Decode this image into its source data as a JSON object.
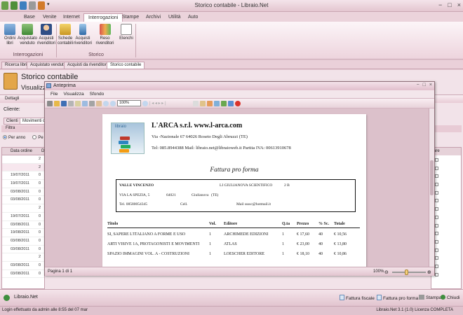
{
  "app": {
    "title": "Storico contabile - Libraio.Net",
    "qat_icons": [
      "app-icon",
      "save-icon",
      "refresh-icon",
      "print-icon",
      "undo-icon",
      "dropdown-icon"
    ],
    "window_controls": [
      "−",
      "□",
      "×"
    ]
  },
  "ribbon": {
    "tabs": [
      "Base",
      "Venite",
      "Internet",
      "Interrogazioni",
      "Stampe",
      "Archivi",
      "Utilità",
      "Auto"
    ],
    "active_tab": "Interrogazioni",
    "groups": [
      {
        "label": "Interrogazioni",
        "buttons": [
          {
            "label1": "Ordini",
            "label2": "libri",
            "icon": "books-order-icon"
          },
          {
            "label1": "Acquistato",
            "label2": "venduto",
            "icon": "purchase-sales-icon"
          },
          {
            "label1": "Acquisti",
            "label2": "rivenditori",
            "icon": "reseller-purchase-icon"
          }
        ]
      },
      {
        "label": "Storico",
        "buttons": [
          {
            "label1": "Schede",
            "label2": "contabili",
            "icon": "accounting-cards-icon"
          },
          {
            "label1": "Acquisti",
            "label2": "rivenditori",
            "icon": "reseller-history-icon"
          },
          {
            "label1": "Reso rivenditori",
            "label2": "",
            "icon": "returns-icon"
          },
          {
            "label1": "Elenchi",
            "label2": "",
            "icon": "lists-icon"
          }
        ]
      }
    ]
  },
  "doc_tabs": [
    "Ricerca libri",
    "Acquistato venduto",
    "Acquisti da rivenditore",
    "Storico contabile"
  ],
  "doc_tab_active": "Storico contabile",
  "main": {
    "title": "Storico contabile",
    "subtitle": "Visualizza",
    "section": "Dettagli",
    "cliente_label": "Cliente:",
    "subtabs": [
      "Clienti",
      "Movimenti co"
    ],
    "filter_label": "Filtra",
    "radio_options": [
      "Per anno",
      "Pe"
    ],
    "grid_header": "Data ordine",
    "grid_header2": "D",
    "grid_rows": [
      {
        "date": "",
        "c": "2"
      },
      {
        "date": "",
        "c": "2"
      },
      {
        "date": "19/07/2011",
        "c": "0"
      },
      {
        "date": "19/07/2011",
        "c": "0"
      },
      {
        "date": "03/08/2011",
        "c": "0"
      },
      {
        "date": "03/08/2011",
        "c": "0"
      },
      {
        "date": "",
        "c": "2"
      },
      {
        "date": "19/07/2011",
        "c": "0"
      },
      {
        "date": "03/08/2011",
        "c": "0"
      },
      {
        "date": "19/08/2011",
        "c": "0"
      },
      {
        "date": "03/08/2011",
        "c": "0"
      },
      {
        "date": "03/08/2011",
        "c": "0"
      },
      {
        "date": "",
        "c": "2"
      },
      {
        "date": "03/08/2011",
        "c": "0"
      },
      {
        "date": "03/08/2011",
        "c": "0"
      }
    ],
    "right_header": "are"
  },
  "preview": {
    "title": "Anteprima",
    "menu": [
      "File",
      "Visualizza",
      "Sfondo"
    ],
    "zoom": "100%",
    "page_status": "Pagina 1 di 1",
    "zoom_status": "100%",
    "invoice": {
      "logo_text": "libraio",
      "company": "L'ARCA s.r.l.  www.l-arca.com",
      "address": "Via -Nazionale 67 64026 Roseto Degli Abruzzi (TE)",
      "contacts": "Tel: 085.8944388 Mail: libraio.net@libraioweb.it Partita IVA: 00613910678",
      "doc_type": "Fattura pro forma",
      "customer": {
        "name": "VALLE VINCENZO",
        "school": "LI GIULIANOVA SCIENTIFICO",
        "class": "2 B",
        "street": "VIA LA SPEZIA, 5",
        "cap": "64021",
        "city": "Giulianova",
        "prov": "(TE)",
        "phone": "Tel. 08580054345",
        "cell": "Cell.",
        "mail": "Mail ssssc@hotmail.it"
      },
      "columns": [
        "Titolo",
        "Vol.",
        "Editore",
        "Q.ta",
        "Prezzo",
        "% Sc.",
        "Totale"
      ],
      "rows": [
        {
          "titolo": "SI, SAPERE L'ITALIANO A FORME E USO",
          "vol": "1",
          "editore": "ARCHIMEDE EDIZIONI",
          "qta": "1",
          "prezzo": "€ 17,60",
          "sc": "40",
          "totale": "€ 10,56"
        },
        {
          "titolo": "ARTI VISIVE 1A, PROTAGONISTI E MOVIMENTI",
          "vol": "1",
          "editore": "ATLAS",
          "qta": "1",
          "prezzo": "€ 23,00",
          "sc": "40",
          "totale": "€ 13,80"
        },
        {
          "titolo": "SPAZIO IMMAGINI VOL. A - COSTRUZIONI",
          "vol": "1",
          "editore": "LOESCHER EDITORE",
          "qta": "1",
          "prezzo": "€ 18,10",
          "sc": "40",
          "totale": "€ 10,86"
        }
      ]
    }
  },
  "bottom": {
    "left_label": "Libraio.Net",
    "buttons": [
      "Fattura fiscale",
      "Fattura pro forma",
      "Stampa",
      "Chiudi"
    ]
  },
  "status": {
    "left": "Login effettuato da admin alle 8:55 del 07 mar",
    "right": "Libraio.Net 3.1 (1.0) Licenza COMPLETA"
  },
  "colors": {
    "ribbon_bg": "#edd4dd",
    "accent": "#c9a7b3",
    "close_red": "#d9332b"
  }
}
